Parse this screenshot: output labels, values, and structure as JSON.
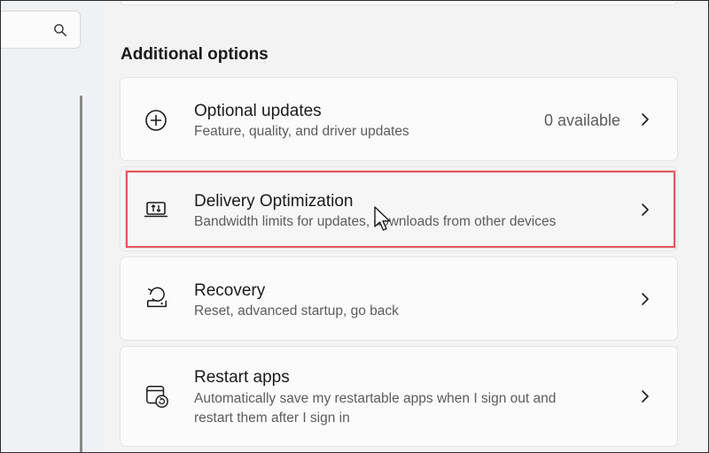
{
  "search": {
    "icon": "search-icon"
  },
  "section": {
    "title": "Additional options"
  },
  "cards": [
    {
      "icon": "add-circle-icon",
      "title": "Optional updates",
      "description": "Feature, quality, and driver updates",
      "status": "0 available"
    },
    {
      "icon": "delivery-optimization-icon",
      "title": "Delivery Optimization",
      "description": "Bandwidth limits for updates, downloads from other devices",
      "highlighted": true
    },
    {
      "icon": "recovery-icon",
      "title": "Recovery",
      "description": "Reset, advanced startup, go back"
    },
    {
      "icon": "restart-apps-icon",
      "title": "Restart apps",
      "description_line1": "Automatically save my restartable apps when I sign out and",
      "description_line2": "restart them after I sign in"
    }
  ],
  "colors": {
    "highlight_outline": "#e05a5f",
    "card_background": "#fbfbfb",
    "page_background": "#f3f3f3"
  }
}
